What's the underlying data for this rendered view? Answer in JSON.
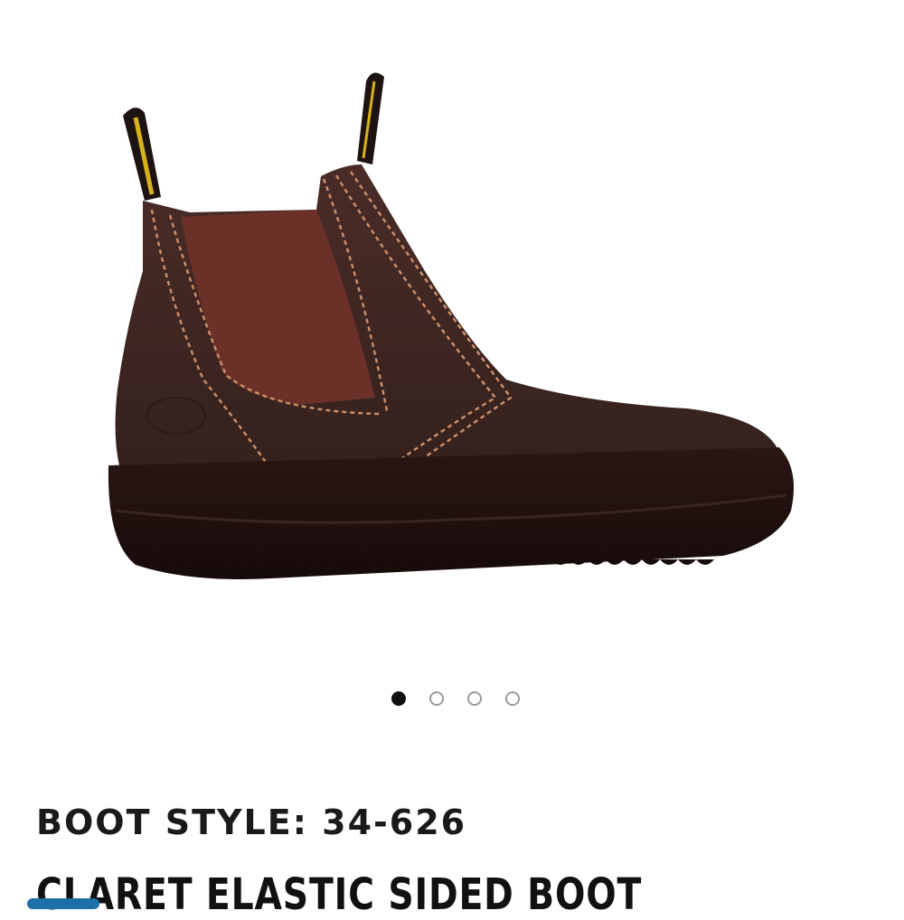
{
  "product": {
    "style_code": "BOOT STYLE: 34-626",
    "title": "CLARET ELASTIC SIDED BOOT"
  },
  "gallery": {
    "image_count": 4,
    "active_index": 0,
    "image_icon": "elastic-sided-boot-photo"
  },
  "colors": {
    "leather": "#3f2521",
    "elastic": "#6b3128",
    "sole": "#24110f",
    "stitching": "#c98d6a",
    "pull_tab": "#d8b21c",
    "accent": "#1e6fa8"
  }
}
